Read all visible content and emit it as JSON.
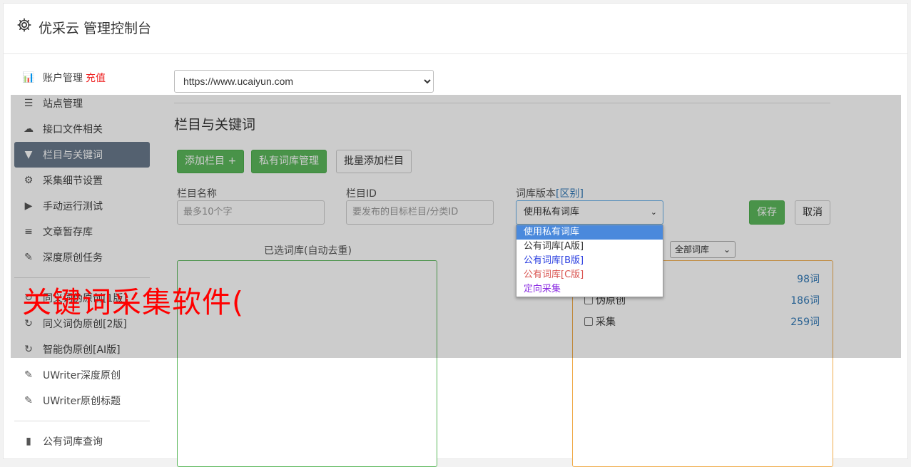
{
  "header": {
    "title": "优采云 管理控制台",
    "icon": "gear-icon"
  },
  "sidebar": {
    "items": [
      {
        "label": "账户管理",
        "badge": "充值",
        "icon": "bar-chart-icon"
      },
      {
        "label": "站点管理",
        "icon": "server-icon"
      },
      {
        "label": "接口文件相关",
        "icon": "cloud-upload-icon"
      },
      {
        "label": "栏目与关键词",
        "icon": "filter-icon",
        "active": true
      },
      {
        "label": "采集细节设置",
        "icon": "gears-icon"
      },
      {
        "label": "手动运行测试",
        "icon": "play-circle-icon"
      },
      {
        "label": "文章暂存库",
        "icon": "database-icon"
      },
      {
        "label": "深度原创任务",
        "icon": "edit-icon"
      },
      {
        "label": "同义词伪原创[1版]",
        "icon": "refresh-icon"
      },
      {
        "label": "同义词伪原创[2版]",
        "icon": "refresh-icon"
      },
      {
        "label": "智能伪原创[AI版]",
        "icon": "refresh-icon"
      },
      {
        "label": "UWriter深度原创",
        "icon": "edit-icon"
      },
      {
        "label": "UWriter原创标题",
        "icon": "edit-icon"
      },
      {
        "label": "公有词库查询",
        "icon": "book-icon"
      }
    ]
  },
  "main": {
    "site_select": "https://www.ucaiyun.com",
    "section_title": "栏目与关键词",
    "buttons": {
      "add_column": "添加栏目 +",
      "private_lib": "私有词库管理",
      "batch_add": "批量添加栏目",
      "save": "保存",
      "cancel": "取消"
    },
    "form": {
      "name_label": "栏目名称",
      "name_placeholder": "最多10个字",
      "id_label": "栏目ID",
      "id_placeholder": "要发布的目标栏目/分类ID",
      "lib_label": "词库版本",
      "lib_diff_link": "[区别]",
      "lib_selected": "使用私有词库"
    },
    "selected_panel_title": "已选词库(自动去重)",
    "lib_filter": "全部词库",
    "lib_rows": [
      {
        "name": "",
        "count": "98词"
      },
      {
        "name": "伪原创",
        "count": "186词"
      },
      {
        "name": "采集",
        "count": "259词"
      }
    ],
    "dropdown_options": [
      "使用私有词库",
      "公有词库[A版]",
      "公有词库[B版]",
      "公有词库[C版]",
      "定向采集"
    ]
  },
  "watermark": "关键词采集软件(",
  "colors": {
    "active_nav": "#697a8c",
    "green": "#5cb85c",
    "link": "#337ab7",
    "recharge": "#ee2222",
    "watermark": "#ff0000"
  }
}
